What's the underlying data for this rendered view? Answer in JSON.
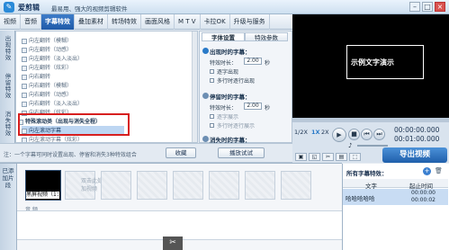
{
  "titlebar": {
    "logo_glyph": "✎",
    "app_name": "爱剪辑",
    "slogan": "最易用、强大的视频剪辑软件",
    "min": "–",
    "max": "□",
    "close": "×"
  },
  "menu": {
    "tabs": [
      "视频",
      "音频",
      "字幕特效",
      "叠加素材",
      "转场特效",
      "画面风格",
      "M T V",
      "卡拉OK",
      "升级与服务"
    ],
    "active": 2
  },
  "left_categories": [
    "出现特效",
    "停留特效",
    "消失特效"
  ],
  "effects": [
    {
      "label": "向左翻转（模糊）",
      "group": false
    },
    {
      "label": "向左翻转（动感）",
      "group": false
    },
    {
      "label": "向左翻转（淡入淡出）",
      "group": false
    },
    {
      "label": "向左翻转（炫彩）",
      "group": false
    },
    {
      "label": "向右翻转",
      "group": false
    },
    {
      "label": "向右翻转（模糊）",
      "group": false
    },
    {
      "label": "向右翻转（动感）",
      "group": false
    },
    {
      "label": "向右翻转（淡入淡出）",
      "group": false
    },
    {
      "label": "向右翻转（炫彩）",
      "group": false
    },
    {
      "label": "特殊滚动类（出现与消失全程）",
      "group": true
    },
    {
      "label": "向左滚动字幕",
      "group": false,
      "selected": true
    },
    {
      "label": "向左滚动字幕（炫彩）",
      "group": false
    }
  ],
  "panel": {
    "tabs": [
      "字体设置",
      "特效参数"
    ],
    "appear_title": "出现时的字幕：",
    "appear_duration_label": "特效时长：",
    "appear_duration": "2.00",
    "unit": "秒",
    "appear_opt1": "逐字出现",
    "appear_opt2": "多行时逐行出现",
    "stay_title": "停留时的字幕：",
    "stay_duration_label": "特效时长：",
    "stay_duration": "2.00",
    "stay_opt1": "逐字展示",
    "stay_opt2": "多行时逐行展示",
    "disappear_title": "消失时的字幕："
  },
  "bottom": {
    "note": "注：一个字幕可同时设置出现、停留和消失3种特效组合",
    "collect_label": "收藏",
    "play_test_label": "播放试试"
  },
  "preview": {
    "caption": "示例文字演示"
  },
  "controls": {
    "speed_1": "1/2X",
    "speed_2": "1X",
    "speed_3": "2X",
    "play_glyph": "▶",
    "stop_glyph": "■",
    "prev_glyph": "⏮",
    "next_glyph": "⏭",
    "vol_glyph": "♪",
    "time_current": "00:00:00.000",
    "time_total": "00:01:00.000"
  },
  "tools": [
    "▣",
    "◱",
    "✂",
    "▤",
    "⬚"
  ],
  "export_label": "导出视频",
  "timeline": {
    "added_label": "已添加片段",
    "clip_label": "黑屏视频（1：",
    "hint": "双击此处添加视频",
    "track_label": "音 频",
    "scissors": "✂"
  },
  "right_panel": {
    "title": "所有字幕特效：",
    "col1": "文字",
    "col2": "起止时间",
    "row_text": "哈哈哈哈哈",
    "row_start": "00:00:00",
    "row_end": "00:00:02"
  },
  "colors": {
    "accent": "#1f5aa8",
    "highlight": "#d71f1f",
    "selection": "#bdd6f2"
  }
}
